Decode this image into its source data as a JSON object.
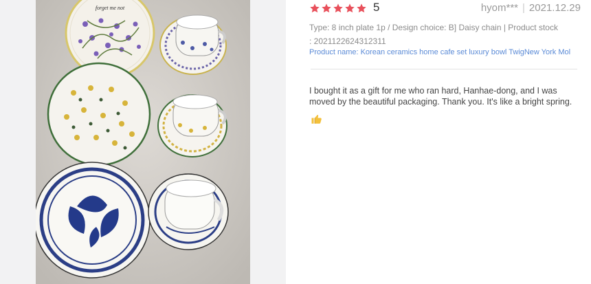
{
  "review": {
    "rating_value": 5,
    "score": "5",
    "user": "hyom***",
    "separator": "|",
    "date": "2021.12.29",
    "option_line1": "Type: 8 inch plate 1p / Design choice: B] Daisy chain | Product stock",
    "option_line2": ": 2021122624312311",
    "product_name": "Product name: Korean ceramics home cafe set luxury bowl TwigNew York Molly...",
    "body_line1": "I bought it as a gift for me who ran hard, Hanhae-dong, and I was",
    "body_line2": "moved by the beautiful packaging. Thank you. It's like a bright spring.",
    "emoji_icon": "thumbs-up-icon",
    "star_color": "#e8505b"
  },
  "photo": {
    "plate_text": "forget me not"
  }
}
